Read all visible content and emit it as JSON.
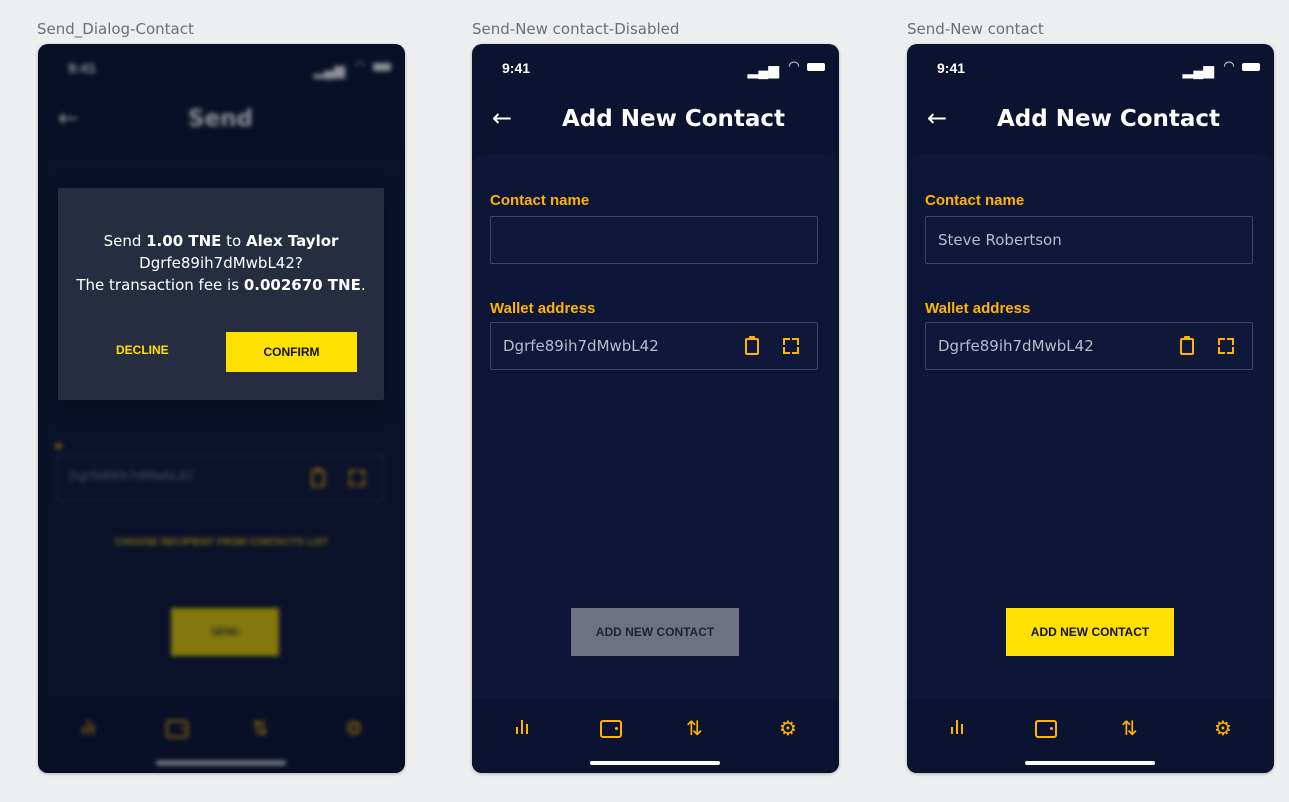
{
  "frames": {
    "dialog_label": "Send_Dialog-Contact",
    "disabled_label": "Send-New contact-Disabled",
    "enabled_label": "Send-New contact"
  },
  "status": {
    "time": "9:41"
  },
  "dialog_screen": {
    "title": "Send",
    "address": "Dgrfe89ih7dMwbL42",
    "choose_link": "CHOOSE RECIPIENT FROM CONTACTS LIST",
    "send_button": "SEND",
    "dialog": {
      "send_word": "Send",
      "amount": "1.00 TNE",
      "to_word": "to",
      "recipient": "Alex Taylor",
      "address_line": "Dgrfe89ih7dMwbL42?",
      "fee_prefix": "The transaction fee is",
      "fee": "0.002670 TNE",
      "fee_suffix": ".",
      "decline": "DECLINE",
      "confirm": "CONFIRM"
    }
  },
  "add_contact": {
    "title": "Add New Contact",
    "contact_name_label": "Contact name",
    "wallet_address_label": "Wallet address",
    "wallet_address_value": "Dgrfe89ih7dMwbL42",
    "add_button": "ADD NEW CONTACT",
    "filled_contact_name": "Steve Robertson"
  },
  "colors": {
    "background": "#0b1330",
    "accent": "#ffb400",
    "button_yellow": "#ffe100",
    "button_disabled": "#6d7183"
  }
}
